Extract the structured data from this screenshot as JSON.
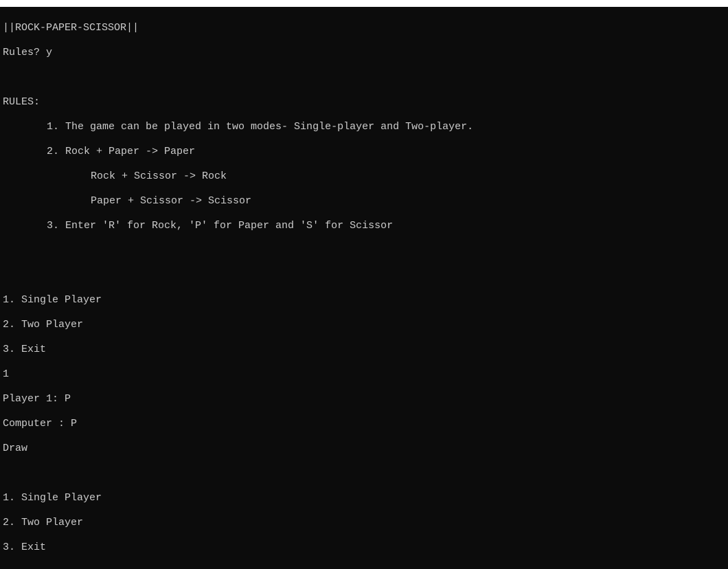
{
  "titlebar": {},
  "terminal": {
    "banner": "||ROCK-PAPER-SCISSOR||",
    "rules_prompt": "Rules? y",
    "rules_header": "RULES:",
    "rules": {
      "r1": "1. The game can be played in two modes- Single-player and Two-player.",
      "r2": "2. Rock + Paper -> Paper",
      "r2a": "Rock + Scissor -> Rock",
      "r2b": "Paper + Scissor -> Scissor",
      "r3": "3. Enter 'R' for Rock, 'P' for Paper and 'S' for Scissor"
    },
    "menu": {
      "m1": "1. Single Player",
      "m2": "2. Two Player",
      "m3": "3. Exit"
    },
    "session": {
      "choice": "1",
      "player1": "Player 1: P",
      "computer": "Computer : P",
      "result": "Draw"
    },
    "menu2": {
      "m1": "1. Single Player",
      "m2": "2. Two Player",
      "m3": "3. Exit"
    }
  }
}
